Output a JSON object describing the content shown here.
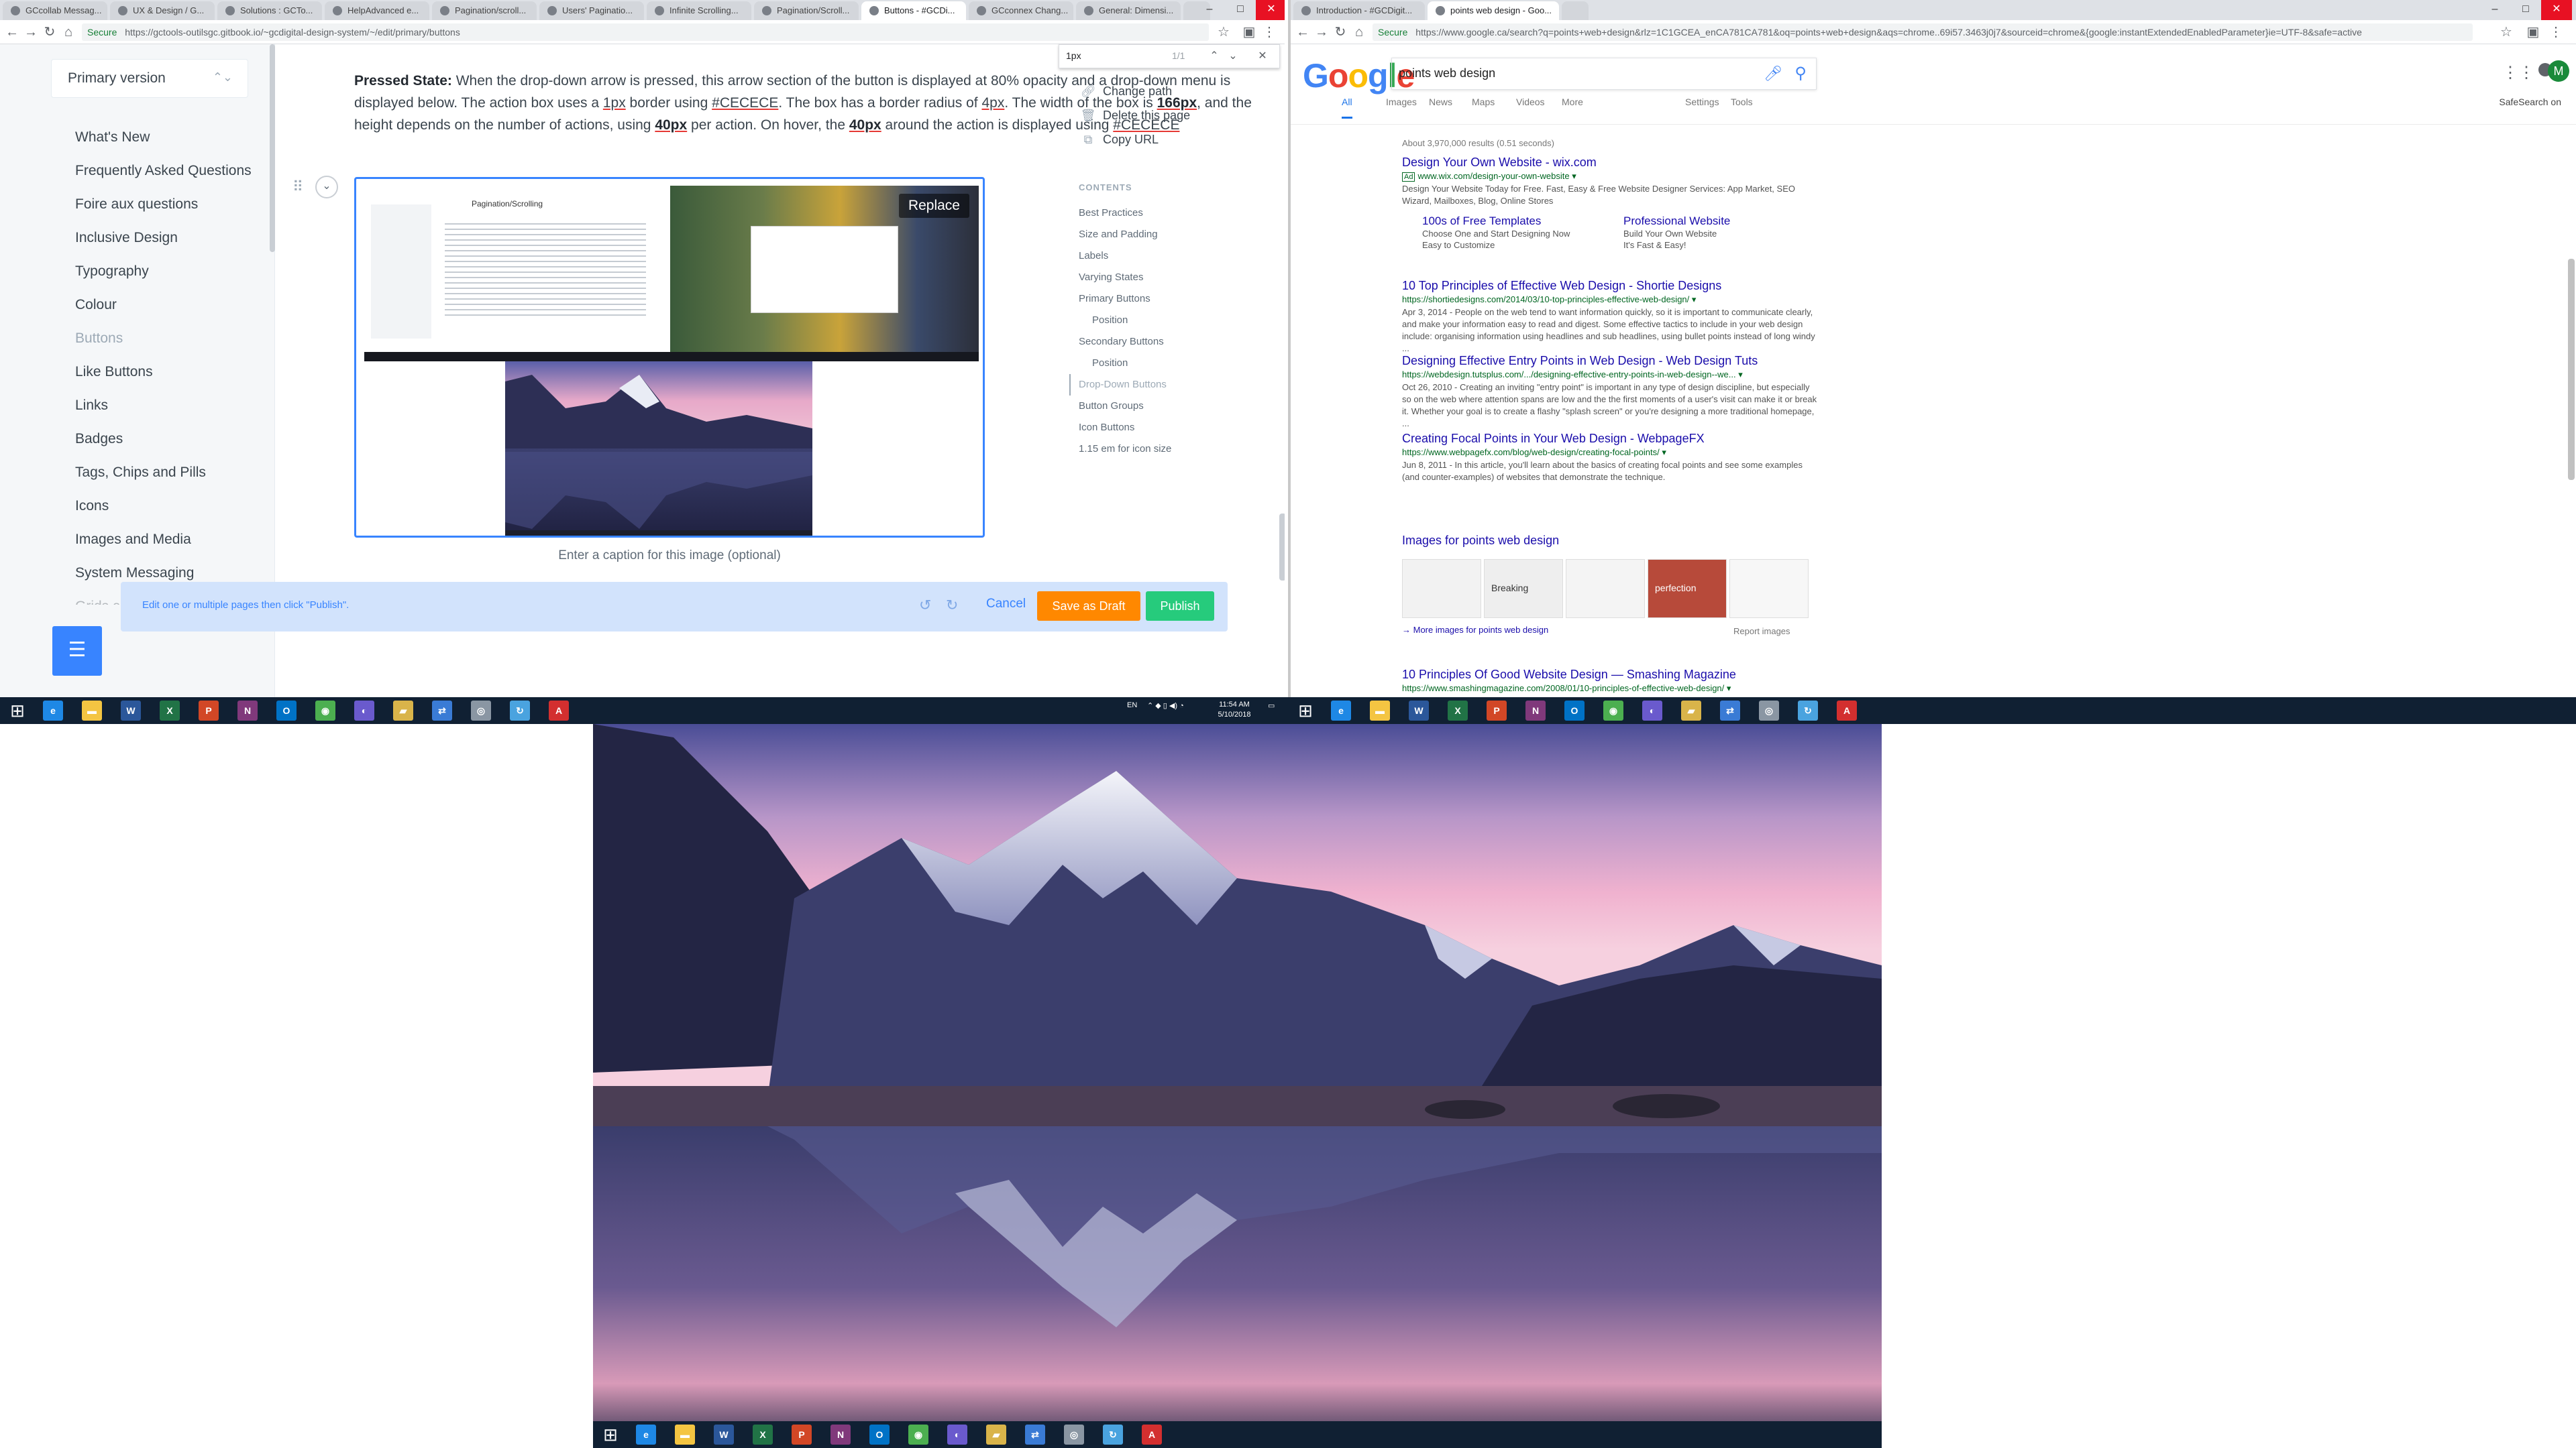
{
  "left_browser": {
    "tabs": [
      {
        "label": "GCcollab Messag..."
      },
      {
        "label": "UX & Design / G..."
      },
      {
        "label": "Solutions : GCTo..."
      },
      {
        "label": "HelpAdvanced e..."
      },
      {
        "label": "Pagination/scroll..."
      },
      {
        "label": "Users' Paginatio..."
      },
      {
        "label": "Infinite Scrolling..."
      },
      {
        "label": "Pagination/Scroll..."
      },
      {
        "label": "Buttons - #GCDi..."
      },
      {
        "label": "GCconnex Chang..."
      },
      {
        "label": "General: Dimensi..."
      }
    ],
    "url_secure": "Secure",
    "url": "https://gctools-outilsgc.gitbook.io/~gcdigital-design-system/~/edit/primary/buttons"
  },
  "gitbook": {
    "version_select": "Primary version",
    "nav": [
      {
        "label": "What's New"
      },
      {
        "label": "Frequently Asked Questions"
      },
      {
        "label": "Foire aux questions"
      },
      {
        "label": "Inclusive Design"
      },
      {
        "label": "Typography"
      },
      {
        "label": "Colour"
      },
      {
        "label": "Buttons"
      },
      {
        "label": "Like Buttons"
      },
      {
        "label": "Links"
      },
      {
        "label": "Badges"
      },
      {
        "label": "Tags, Chips and Pills"
      },
      {
        "label": "Icons"
      },
      {
        "label": "Images and Media"
      },
      {
        "label": "System Messaging"
      },
      {
        "label": "Grids and Spacing"
      }
    ],
    "paragraph": {
      "lead": "Pressed State:",
      "t1": " When the drop-down arrow is pressed, this arrow section of the button is displayed at 80% opacity and a drop-down menu is displayed below. The action box uses a ",
      "v1": "1px",
      "t2": " border using ",
      "v2": "#CECECE",
      "t3": ". The box has a border radius of ",
      "v3": "4px",
      "t4": ". The width of the box is ",
      "v4": "166px",
      "t5": ", and the height depends on the number of actions, using ",
      "v5": "40px",
      "t6": " per action. On hover, the ",
      "v6": "40px",
      "t7": " around the action is displayed using ",
      "v7": "#CECECE"
    },
    "image_block": {
      "replace_label": "Replace",
      "inner_title": "Pagination/Scrolling",
      "caption_placeholder": "Enter a caption for this image (optional)"
    },
    "find": {
      "query": "1px",
      "count": "1/1"
    },
    "page_actions": [
      {
        "label": "Change path",
        "icon": "link-icon"
      },
      {
        "label": "Delete this page",
        "icon": "trash-icon"
      },
      {
        "label": "Copy URL",
        "icon": "copy-icon"
      }
    ],
    "toc_title": "CONTENTS",
    "toc": [
      {
        "label": "Best Practices",
        "level": 1
      },
      {
        "label": "Size and Padding",
        "level": 1
      },
      {
        "label": "Labels",
        "level": 1
      },
      {
        "label": "Varying States",
        "level": 1
      },
      {
        "label": "Primary Buttons",
        "level": 1
      },
      {
        "label": "Position",
        "level": 2
      },
      {
        "label": "Secondary Buttons",
        "level": 1
      },
      {
        "label": "Position",
        "level": 2
      },
      {
        "label": "Drop-Down Buttons",
        "level": 1,
        "active": true
      },
      {
        "label": "Button Groups",
        "level": 1
      },
      {
        "label": "Icon Buttons",
        "level": 1
      },
      {
        "label": "1.15 em for icon size",
        "level": 1
      }
    ],
    "publish_bar": {
      "message": "Edit one or multiple pages then click \"Publish\".",
      "cancel": "Cancel",
      "save_draft": "Save as Draft",
      "publish": "Publish"
    }
  },
  "right_browser": {
    "tabs": [
      {
        "label": "Introduction - #GCDigit..."
      },
      {
        "label": "points web design - Goo..."
      }
    ],
    "url_secure": "Secure",
    "url": "https://www.google.ca/search?q=points+web+design&rlz=1C1GCEA_enCA781CA781&oq=points+web+design&aqs=chrome..69i57.3463j0j7&sourceid=chrome&{google:instantExtendedEnabledParameter}ie=UTF-8&safe=active"
  },
  "google": {
    "logo": [
      "G",
      "o",
      "o",
      "g",
      "l",
      "e"
    ],
    "logo_colors": [
      "#4285f4",
      "#ea4335",
      "#fbbc05",
      "#4285f4",
      "#34a853",
      "#ea4335"
    ],
    "query": "points web design",
    "avatar_initial": "M",
    "tabs": [
      {
        "label": "All",
        "active": true
      },
      {
        "label": "Images"
      },
      {
        "label": "News"
      },
      {
        "label": "Maps"
      },
      {
        "label": "Videos"
      },
      {
        "label": "More"
      },
      {
        "label": "Settings"
      },
      {
        "label": "Tools"
      }
    ],
    "safesearch": "SafeSearch on",
    "stats": "About 3,970,000 results (0.51 seconds)",
    "results": [
      {
        "title": "Design Your Own Website - wix.com",
        "ad": "Ad",
        "url": "www.wix.com/design-your-own-website",
        "snippet": "Design Your Website Today for Free. Fast, Easy & Free Website Designer Services: App Market, SEO Wizard, Mailboxes, Blog, Online Stores"
      },
      {
        "title": "10 Top Principles of Effective Web Design - Shortie Designs",
        "url": "https://shortiedesigns.com/2014/03/10-top-principles-effective-web-design/",
        "snippet": "Apr 3, 2014 - People on the web tend to want information quickly, so it is important to communicate clearly, and make your information easy to read and digest. Some effective tactics to include in your web design include: organising information using headlines and sub headlines, using bullet points instead of long windy ..."
      },
      {
        "title": "Designing Effective Entry Points in Web Design - Web Design Tuts",
        "url": "https://webdesign.tutsplus.com/.../designing-effective-entry-points-in-web-design--we...",
        "snippet": "Oct 26, 2010 - Creating an inviting \"entry point\" is important in any type of design discipline, but especially so on the web where attention spans are low and the the first moments of a user's visit can make it or break it. Whether your goal is to create a flashy \"splash screen\" or you're designing a more traditional homepage, ..."
      },
      {
        "title": "Creating Focal Points in Your Web Design - WebpageFX",
        "url": "https://www.webpagefx.com/blog/web-design/creating-focal-points/",
        "snippet": "Jun 8, 2011 - In this article, you'll learn about the basics of creating focal points and see some examples (and counter-examples) of websites that demonstrate the technique."
      },
      {
        "title": "10 Principles Of Good Website Design — Smashing Magazine",
        "url": "https://www.smashingmagazine.com/2008/01/10-principles-of-effective-web-design/",
        "snippet": ""
      }
    ],
    "sitelinks": [
      {
        "title": "100s of Free Templates",
        "l1": "Choose One and Start Designing Now",
        "l2": "Easy to Customize"
      },
      {
        "title": "Professional Website",
        "l1": "Build Your Own Website",
        "l2": "It's Fast & Easy!"
      }
    ],
    "images_heading": "Images for points web design",
    "thumb_labels": [
      "",
      "Breaking",
      "",
      "perfection",
      ""
    ],
    "more_images": "More images for points web design",
    "report_images": "Report images"
  },
  "taskbar": {
    "apps": [
      {
        "icon": "ie-icon",
        "glyph": "e",
        "color": "#1e88e5"
      },
      {
        "icon": "file-explorer-icon",
        "glyph": "▬",
        "color": "#f4c542"
      },
      {
        "icon": "word-icon",
        "glyph": "W",
        "color": "#2b579a"
      },
      {
        "icon": "excel-icon",
        "glyph": "X",
        "color": "#217346"
      },
      {
        "icon": "powerpoint-icon",
        "glyph": "P",
        "color": "#d24726"
      },
      {
        "icon": "onenote-icon",
        "glyph": "N",
        "color": "#80397b"
      },
      {
        "icon": "outlook-icon",
        "glyph": "O",
        "color": "#0072c6"
      },
      {
        "icon": "chrome-icon",
        "glyph": "◉",
        "color": "#4caf50"
      },
      {
        "icon": "app-icon",
        "glyph": "◐",
        "color": "#6a5acd"
      },
      {
        "icon": "folder-icon",
        "glyph": "▰",
        "color": "#d9b44a"
      },
      {
        "icon": "network-icon",
        "glyph": "⇄",
        "color": "#3a7bd5"
      },
      {
        "icon": "settings-app-icon",
        "glyph": "◎",
        "color": "#8a96a3"
      },
      {
        "icon": "sync-app-icon",
        "glyph": "↻",
        "color": "#4aa3df"
      },
      {
        "icon": "acrobat-icon",
        "glyph": "A",
        "color": "#d32f2f"
      }
    ],
    "tray_lang": "EN",
    "time": "11:54 AM",
    "date": "5/10/2018"
  }
}
